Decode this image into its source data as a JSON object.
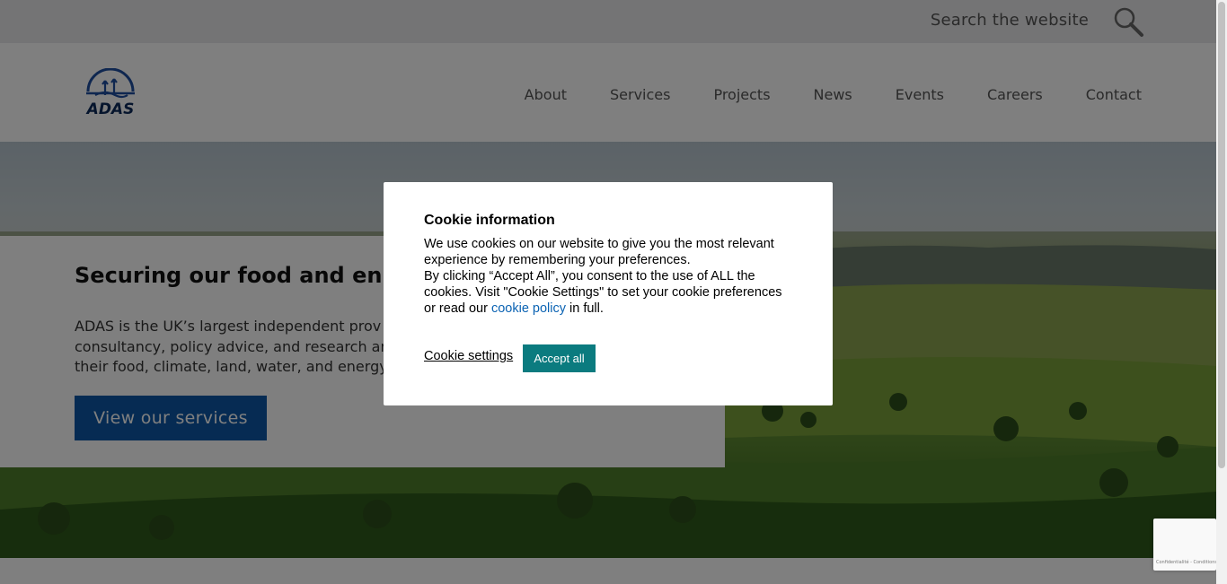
{
  "topbar": {
    "search_placeholder": "Search the website",
    "search_icon": "search-icon"
  },
  "header": {
    "logo_text": "ADAS",
    "nav": [
      "About",
      "Services",
      "Projects",
      "News",
      "Events",
      "Careers",
      "Contact"
    ]
  },
  "hero": {
    "title": "Securing our food and enha",
    "text_lines": [
      "ADAS is the UK’s largest independent prov",
      "consultancy, policy advice, and research an",
      "their food, climate, land, water, and energy"
    ],
    "cta_label": "View our services"
  },
  "cookie": {
    "title": "Cookie information",
    "body_p1": "We use cookies on our website to give you the most relevant experience by remembering your preferences.",
    "body_p2_before": "By clicking “Accept All”, you consent to the use of ALL the cookies. Visit \"Cookie Settings\" to set your cookie preferences or read our ",
    "policy_link": "cookie policy",
    "body_p2_after": " in full.",
    "settings_label": "Cookie settings",
    "accept_label": "Accept all"
  },
  "recaptcha": {
    "text": "Confidentialité - Conditions"
  },
  "colors": {
    "brand_blue": "#0c57a6",
    "accept_teal": "#0b7b7f",
    "link_blue": "#0b63b3",
    "topbar_bg": "#e8e8ea"
  }
}
